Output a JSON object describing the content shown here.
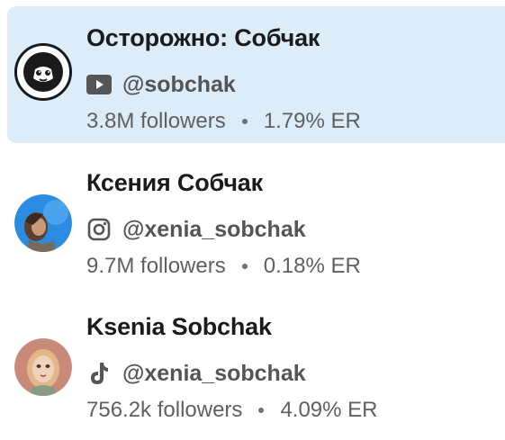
{
  "profiles": [
    {
      "name": "Осторожно: Собчак",
      "platform": "youtube",
      "platform_icon": "youtube-icon",
      "handle": "@sobchak",
      "followers": "3.8M followers",
      "er": "1.79% ER",
      "selected": true
    },
    {
      "name": "Ксения Собчак",
      "platform": "instagram",
      "platform_icon": "instagram-icon",
      "handle": "@xenia_sobchak",
      "followers": "9.7M followers",
      "er": "0.18% ER",
      "selected": false
    },
    {
      "name": "Ksenia Sobchak",
      "platform": "tiktok",
      "platform_icon": "tiktok-icon",
      "handle": "@xenia_sobchak",
      "followers": "756.2k followers",
      "er": "4.09% ER",
      "selected": false
    }
  ],
  "colors": {
    "selected_bg": "#dcecf9",
    "name_text": "#1b1b1b",
    "handle_text": "#555555",
    "stats_text": "#606060"
  }
}
